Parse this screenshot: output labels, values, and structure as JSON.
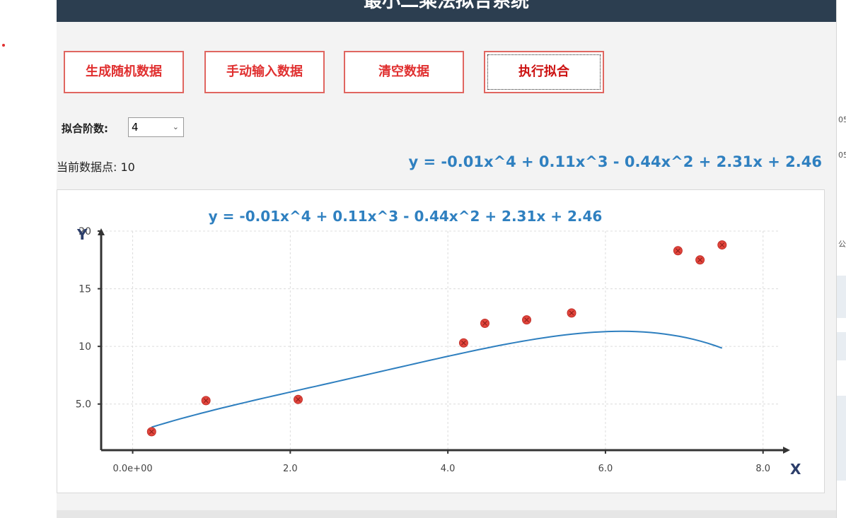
{
  "window": {
    "title": "最小二乘法拟合系统"
  },
  "toolbar": {
    "random_label": "生成随机数据",
    "manual_label": "手动输入数据",
    "clear_label": "清空数据",
    "fit_label": "执行拟合"
  },
  "controls": {
    "degree_label": "拟合阶数:",
    "degree_value": "4",
    "points_label": "当前数据点: 10"
  },
  "formula_text": "y = -0.01x^4 + 0.11x^3 - 0.44x^2 + 2.31x + 2.46",
  "right_fragments": [
    "05",
    "05",
    "公"
  ],
  "colors": {
    "accent_red": "#e03030",
    "formula_blue": "#2f80c0",
    "title_bar": "#2c3e50",
    "point_red": "#e2453c",
    "line_blue": "#2e7fbf"
  },
  "chart_data": {
    "type": "scatter",
    "title": "y = -0.01x^4 + 0.11x^3 - 0.44x^2 + 2.31x + 2.46",
    "xlabel": "X",
    "ylabel": "Y",
    "xlim": [
      -0.4,
      8.2
    ],
    "ylim": [
      1,
      20
    ],
    "x_ticks": [
      0,
      2,
      4,
      6,
      8
    ],
    "x_tick_labels": [
      "0.0e+00",
      "2.0",
      "4.0",
      "6.0",
      "8.0"
    ],
    "y_ticks": [
      5,
      10,
      15,
      20
    ],
    "y_tick_labels": [
      "5.0",
      "10",
      "15",
      "20"
    ],
    "grid": true,
    "points": [
      {
        "x": 0.24,
        "y": 2.6
      },
      {
        "x": 0.93,
        "y": 5.3
      },
      {
        "x": 2.1,
        "y": 5.4
      },
      {
        "x": 4.2,
        "y": 10.3
      },
      {
        "x": 4.47,
        "y": 12.0
      },
      {
        "x": 5.0,
        "y": 12.3
      },
      {
        "x": 5.57,
        "y": 12.9
      },
      {
        "x": 6.92,
        "y": 18.3
      },
      {
        "x": 7.2,
        "y": 17.5
      },
      {
        "x": 7.48,
        "y": 18.8
      }
    ],
    "fit_coefficients": [
      2.46,
      2.31,
      -0.44,
      0.11,
      -0.01
    ],
    "fit_range": [
      0.24,
      7.48
    ]
  }
}
